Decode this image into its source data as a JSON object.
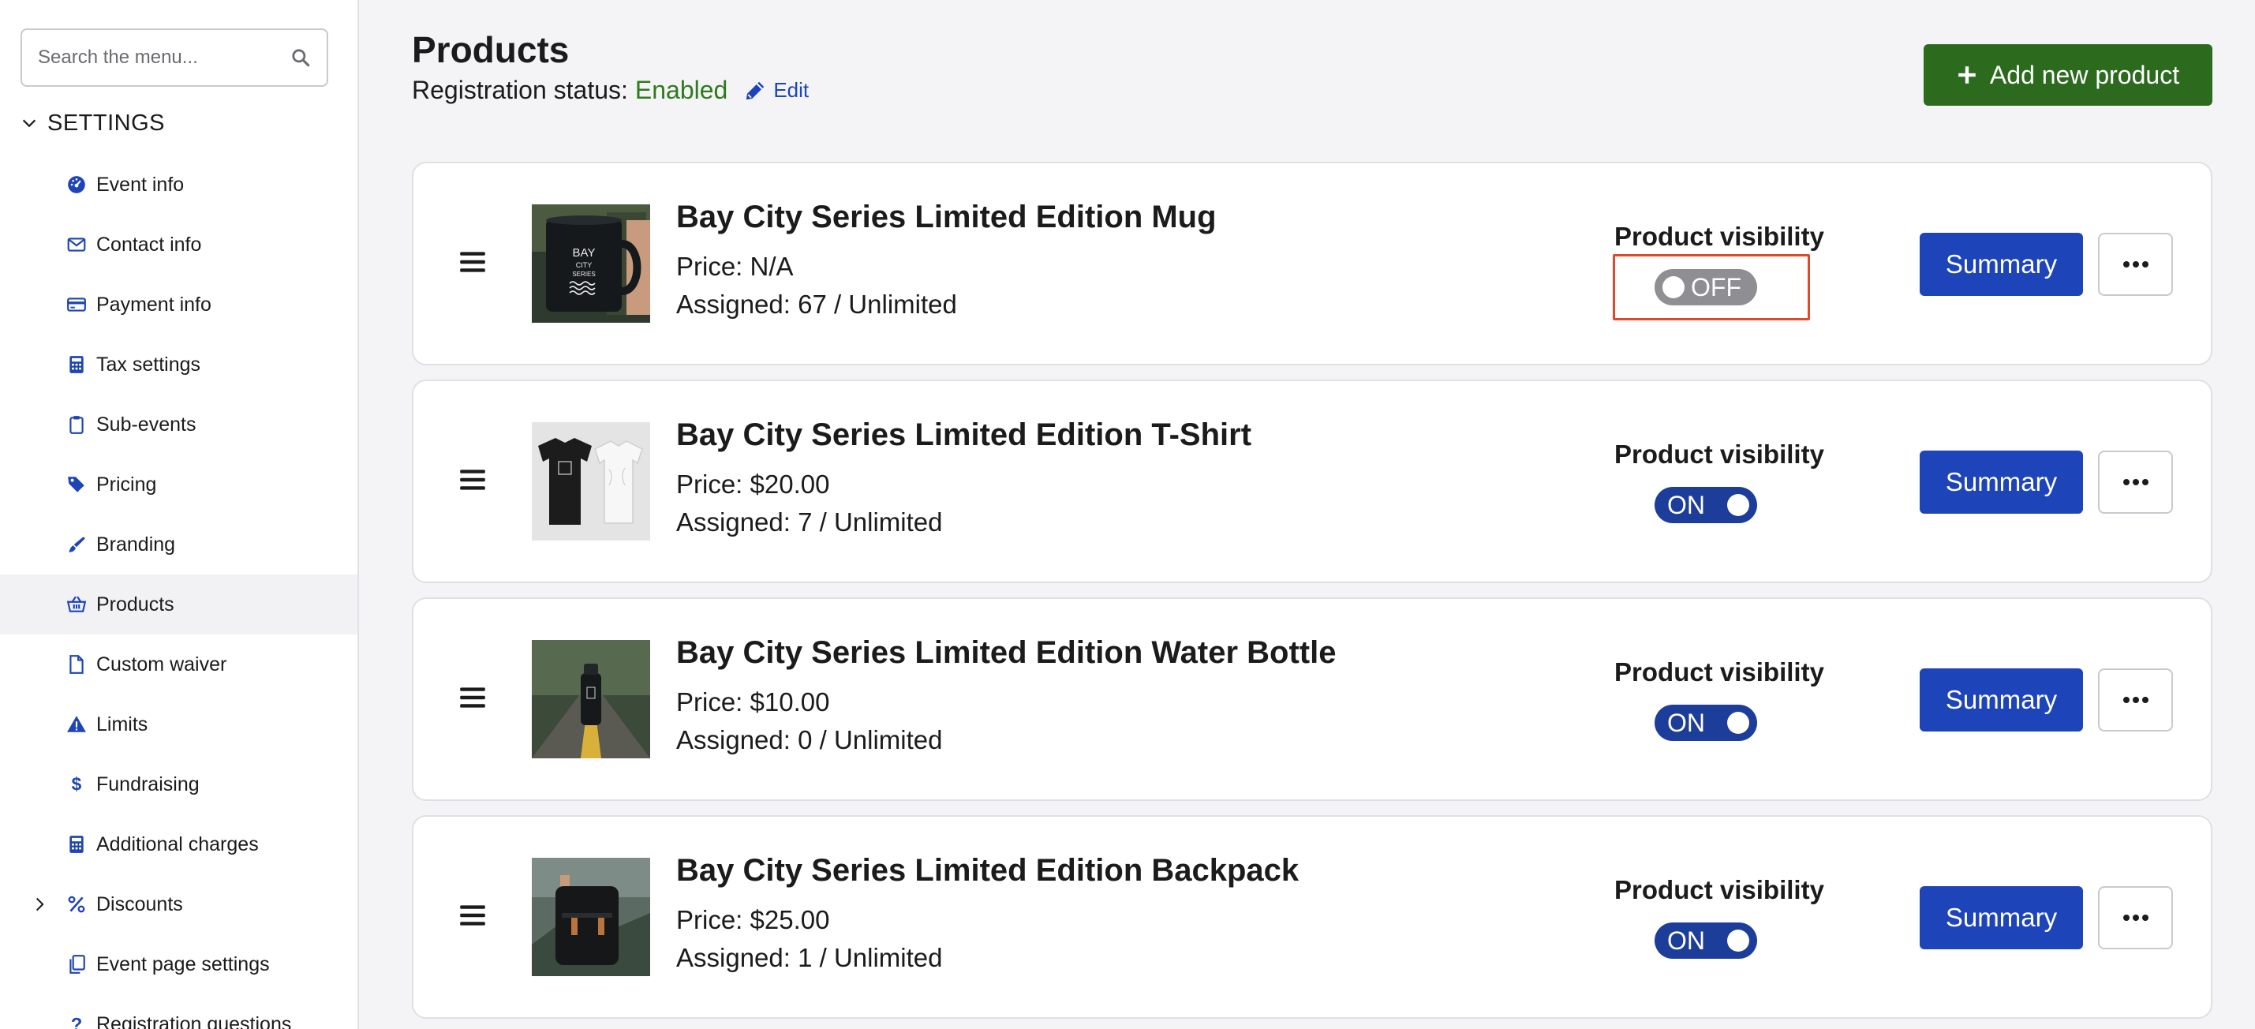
{
  "sidebar": {
    "search_placeholder": "Search the menu...",
    "section_title": "SETTINGS",
    "items": [
      {
        "label": "Event info",
        "icon": "gauge-icon"
      },
      {
        "label": "Contact info",
        "icon": "envelope-icon"
      },
      {
        "label": "Payment info",
        "icon": "credit-card-icon"
      },
      {
        "label": "Tax settings",
        "icon": "calculator-icon"
      },
      {
        "label": "Sub-events",
        "icon": "clipboard-icon"
      },
      {
        "label": "Pricing",
        "icon": "tags-icon"
      },
      {
        "label": "Branding",
        "icon": "paintbrush-icon"
      },
      {
        "label": "Products",
        "icon": "basket-icon",
        "active": true
      },
      {
        "label": "Custom waiver",
        "icon": "document-icon"
      },
      {
        "label": "Limits",
        "icon": "warning-icon"
      },
      {
        "label": "Fundraising",
        "icon": "dollar-icon"
      },
      {
        "label": "Additional charges",
        "icon": "calculator-icon"
      },
      {
        "label": "Discounts",
        "icon": "percent-icon",
        "expandable": true
      },
      {
        "label": "Event page settings",
        "icon": "copy-icon"
      },
      {
        "label": "Registration questions",
        "icon": "question-icon"
      }
    ]
  },
  "header": {
    "title": "Products",
    "registration_label": "Registration status:",
    "registration_value": "Enabled",
    "edit_label": "Edit",
    "add_button": "Add new product"
  },
  "colors": {
    "primary": "#1d44b8",
    "success": "#2c6b1e",
    "enabled_text": "#2e7a1d",
    "toggle_on": "#1d3d9a",
    "toggle_off": "#8e8e93",
    "highlight": "#e04a2c"
  },
  "products": [
    {
      "name": "Bay City Series Limited Edition Mug",
      "price": "Price: N/A",
      "assigned": "Assigned: 67 / Unlimited",
      "visibility_label": "Product visibility",
      "toggle_text": "OFF",
      "summary": "Summary"
    },
    {
      "name": "Bay City Series Limited Edition T-Shirt",
      "price": "Price: $20.00",
      "assigned": "Assigned: 7 / Unlimited",
      "visibility_label": "Product visibility",
      "toggle_text": "ON",
      "summary": "Summary"
    },
    {
      "name": "Bay City Series Limited Edition Water Bottle",
      "price": "Price: $10.00",
      "assigned": "Assigned: 0 / Unlimited",
      "visibility_label": "Product visibility",
      "toggle_text": "ON",
      "summary": "Summary"
    },
    {
      "name": "Bay City Series Limited Edition Backpack",
      "price": "Price: $25.00",
      "assigned": "Assigned: 1 / Unlimited",
      "visibility_label": "Product visibility",
      "toggle_text": "ON",
      "summary": "Summary"
    }
  ],
  "mug_logo": {
    "line1": "BAY",
    "line2": "CITY",
    "line3": "SERIES"
  }
}
